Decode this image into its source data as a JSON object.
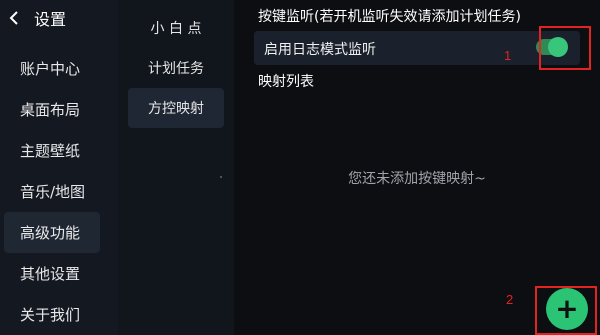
{
  "sidebar": {
    "title": "设置",
    "items": [
      {
        "label": "账户中心"
      },
      {
        "label": "桌面布局"
      },
      {
        "label": "主题壁纸"
      },
      {
        "label": "音乐/地图"
      },
      {
        "label": "高级功能"
      },
      {
        "label": "其他设置"
      },
      {
        "label": "关于我们"
      }
    ],
    "active_index": 4
  },
  "submenu": {
    "items": [
      {
        "label": "小 白 点"
      },
      {
        "label": "计划任务"
      },
      {
        "label": "方控映射"
      }
    ],
    "active_index": 2
  },
  "main": {
    "section_title": "按键监听(若开机监听失效请添加计划任务)",
    "log_mode_label": "启用日志模式监听",
    "log_mode_enabled": true,
    "list_title": "映射列表",
    "empty_text": "您还未添加按键映射~",
    "add_button_symbol": "+"
  },
  "annotations": {
    "marker_1": "1",
    "marker_2": "2",
    "color": "#e32222"
  },
  "colors": {
    "accent_green": "#2ac474",
    "background": "#0c0e12",
    "sidebar_bg": "#131821"
  }
}
